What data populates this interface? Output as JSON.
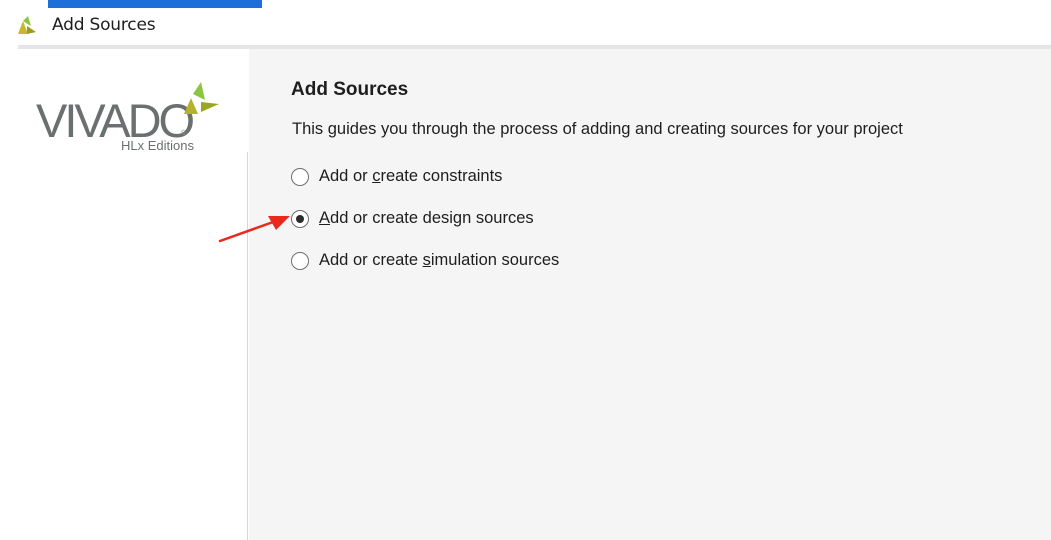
{
  "window": {
    "title": "Add Sources",
    "icon": "vivado-logo-icon"
  },
  "logo": {
    "word": "VIVADO",
    "registered": "®",
    "edition": "HLx Editions",
    "colors": {
      "text": "#6c6f70",
      "mark_green": "#8cc63f",
      "mark_olive": "#b5b12a"
    }
  },
  "main": {
    "heading": "Add Sources",
    "description": "This guides you through the process of adding and creating sources for your project",
    "options": [
      {
        "pre": "Add or ",
        "mnemonic": "c",
        "post": "reate constraints",
        "selected": false
      },
      {
        "pre": "",
        "mnemonic": "A",
        "post": "dd or create design sources",
        "selected": true
      },
      {
        "pre": "Add or create ",
        "mnemonic": "s",
        "post": "imulation sources",
        "selected": false
      }
    ]
  },
  "annotation": {
    "color": "#e8291c",
    "icon": "red-arrow-icon"
  },
  "colors": {
    "accent": "#1e6fd9",
    "panel_bg": "#f5f5f5"
  }
}
